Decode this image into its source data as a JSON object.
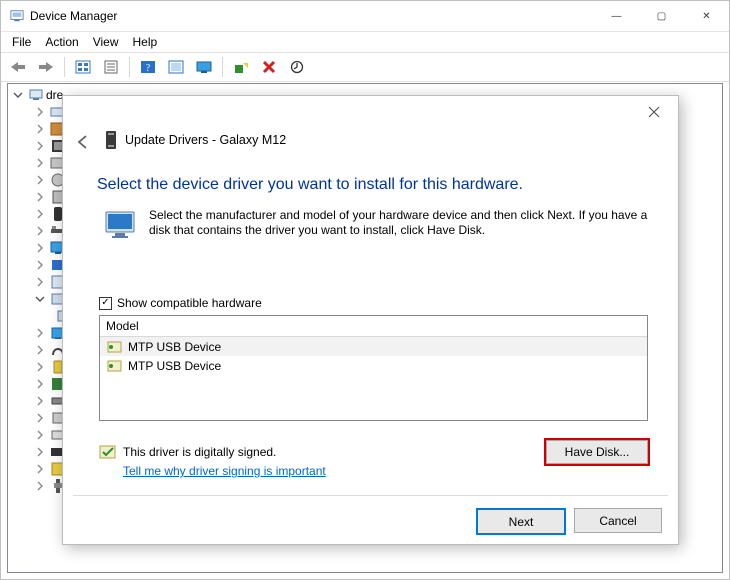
{
  "window": {
    "title": "Device Manager",
    "controls": {
      "min": "—",
      "max": "▢",
      "close": "✕"
    }
  },
  "menu": {
    "file": "File",
    "action": "Action",
    "view": "View",
    "help": "Help"
  },
  "toolbar_tips": {
    "back": "Back",
    "forward": "Forward",
    "show_hidden": "Show hidden devices",
    "properties": "Properties",
    "help": "Help",
    "scan": "Scan for hardware changes",
    "displays": "Display devices",
    "add": "Add legacy hardware",
    "uninstall": "Uninstall device",
    "update": "Update driver"
  },
  "tree": {
    "root": "dre…"
  },
  "modal": {
    "close": "✕",
    "title": "Update Drivers - Galaxy M12",
    "heading": "Select the device driver you want to install for this hardware.",
    "helptext": "Select the manufacturer and model of your hardware device and then click Next. If you have a disk that contains the driver you want to install, click Have Disk.",
    "checkbox_label": "Show compatible hardware",
    "checkbox_checked": "✓",
    "list_header": "Model",
    "list_items": [
      "MTP USB Device",
      "MTP USB Device"
    ],
    "signed_text": "This driver is digitally signed.",
    "signed_link": "Tell me why driver signing is important",
    "have_disk": "Have Disk...",
    "next": "Next",
    "cancel": "Cancel"
  }
}
